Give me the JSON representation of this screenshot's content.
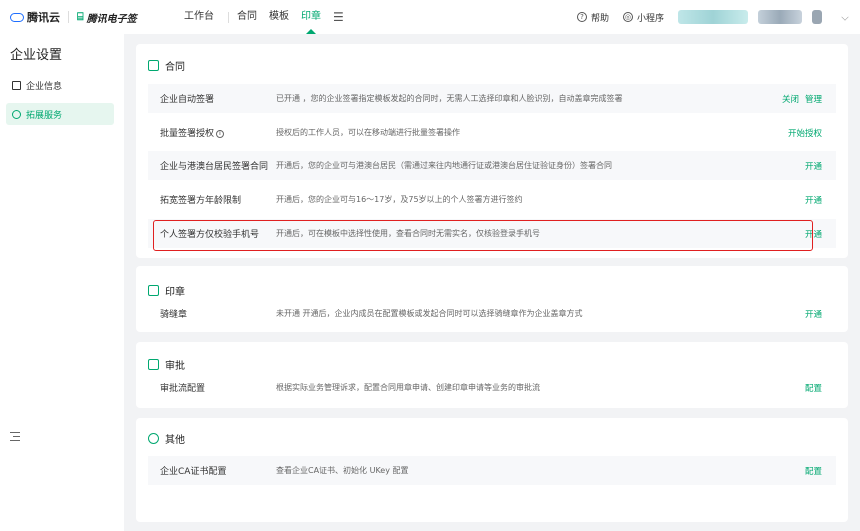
{
  "header": {
    "brand1": "腾讯云",
    "brand2": "腾讯电子签",
    "nav": [
      "工作台",
      "合同",
      "模板",
      "印章"
    ],
    "help": "帮助",
    "miniprogram": "小程序"
  },
  "sidebar": {
    "title": "企业设置",
    "items": [
      {
        "label": "企业信息"
      },
      {
        "label": "拓展服务"
      }
    ]
  },
  "sections": {
    "contract": {
      "title": "合同",
      "rows": [
        {
          "name": "企业自动签署",
          "desc": "已开通 ，您的企业签署指定模板发起的合同时，无需人工选择印章和人脸识别，自动盖章完成签署",
          "action1": "关闭",
          "action2": "管理"
        },
        {
          "name": "批量签署授权",
          "desc": "授权后的工作人员，可以在移动端进行批量签署操作",
          "action1": "开始授权"
        },
        {
          "name": "企业与港澳台居民签署合同",
          "desc": "开通后，您的企业可与港澳台居民（需通过来往内地通行证或港澳台居住证验证身份）签署合同",
          "action1": "开通"
        },
        {
          "name": "拓宽签署方年龄限制",
          "desc": "开通后，您的企业可与16～17岁，及75岁以上的个人签署方进行签约",
          "action1": "开通"
        },
        {
          "name": "个人签署方仅校验手机号",
          "desc": "开通后，可在模板中选择性使用，查看合同时无需实名，仅核验登录手机号",
          "action1": "开通"
        }
      ]
    },
    "seal": {
      "title": "印章",
      "rows": [
        {
          "name": "骑缝章",
          "desc": "未开通   开通后，企业内成员在配置模板或发起合同时可以选择骑缝章作为企业盖章方式",
          "action1": "开通"
        }
      ]
    },
    "approval": {
      "title": "审批",
      "rows": [
        {
          "name": "审批流配置",
          "desc": "根据实际业务管理诉求，配置合同用章申请、创建印章申请等业务的审批流",
          "action1": "配置"
        }
      ]
    },
    "other": {
      "title": "其他",
      "rows": [
        {
          "name": "企业CA证书配置",
          "desc": "查看企业CA证书、初始化 UKey 配置",
          "action1": "配置"
        }
      ]
    }
  },
  "colors": {
    "accent": "#00a870",
    "highlight": "#e02020"
  }
}
